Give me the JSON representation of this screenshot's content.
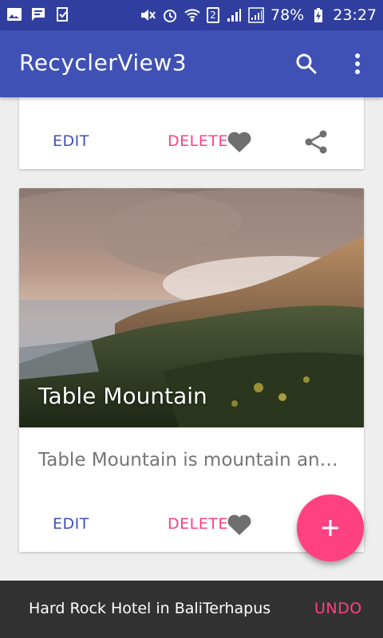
{
  "status_bar": {
    "battery_percent": "78%",
    "time": "23:27",
    "sim_label": "2",
    "icons": [
      "image-icon",
      "message-icon",
      "download-check-icon",
      "mute-icon",
      "alarm-icon",
      "wifi-icon",
      "signal-icon",
      "signal-icon-2",
      "battery-charging-icon"
    ]
  },
  "app_bar": {
    "title": "RecyclerView3",
    "search_icon": "search-icon",
    "menu_icon": "more-vert-icon"
  },
  "cards": [
    {
      "edit_label": "EDIT",
      "delete_label": "DELETE"
    },
    {
      "image_title": "Table Mountain",
      "description": "Table Mountain is mountain an…",
      "edit_label": "EDIT",
      "delete_label": "DELETE"
    }
  ],
  "fab": {
    "icon": "add-icon",
    "label": "+"
  },
  "snackbar": {
    "message": "Hard Rock Hotel in BaliTerhapus",
    "action_label": "UNDO"
  },
  "colors": {
    "status_bar": "#303f9f",
    "primary": "#3f51b5",
    "accent": "#ff4081",
    "snackbar_bg": "#323232"
  }
}
